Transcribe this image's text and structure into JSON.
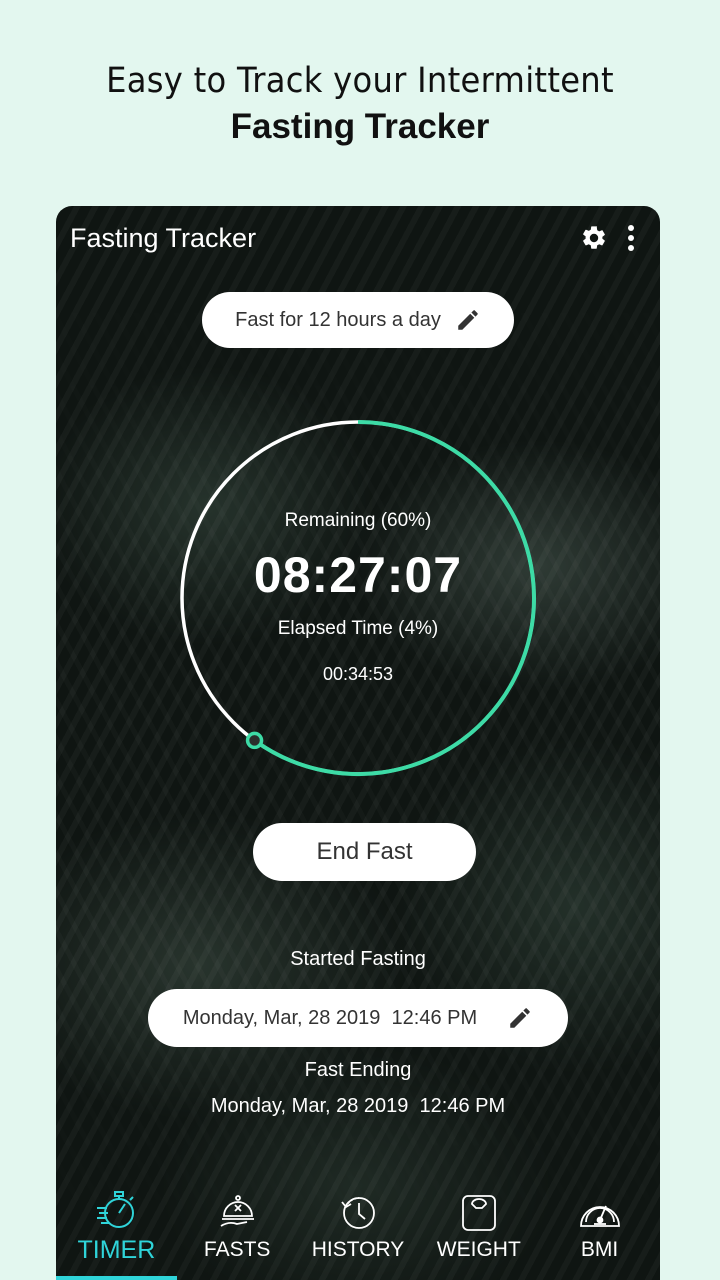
{
  "promo": {
    "line1": "Easy to Track your Intermittent",
    "line2": "Fasting Tracker"
  },
  "appbar": {
    "title": "Fasting Tracker",
    "icons": [
      "gear-icon",
      "more-vert-icon"
    ]
  },
  "plan": {
    "label": "Fast for 12 hours a day",
    "icon": "pencil-icon"
  },
  "timer": {
    "remaining_label": "Remaining (60%)",
    "remaining_time": "08:27:07",
    "elapsed_label": "Elapsed Time (4%)",
    "elapsed_time": "00:34:53",
    "progress_fraction": 0.6,
    "ring_color": "#3ddba6",
    "track_color": "#ffffff"
  },
  "actions": {
    "end_fast": "End Fast"
  },
  "schedule": {
    "start_label": "Started Fasting",
    "start_value": "Monday, Mar, 28 2019  12:46 PM",
    "end_label": "Fast Ending",
    "end_value": "Monday, Mar, 28 2019  12:46 PM"
  },
  "tabs": [
    {
      "label": "TIMER",
      "icon": "stopwatch-icon",
      "active": true
    },
    {
      "label": "FASTS",
      "icon": "cloche-icon",
      "active": false
    },
    {
      "label": "HISTORY",
      "icon": "history-clock-icon",
      "active": false
    },
    {
      "label": "WEIGHT",
      "icon": "scale-icon",
      "active": false
    },
    {
      "label": "BMI",
      "icon": "gauge-icon",
      "active": false
    }
  ],
  "colors": {
    "accent": "#2fd4d9",
    "ring": "#3ddba6",
    "background": "#e3f7ef"
  }
}
